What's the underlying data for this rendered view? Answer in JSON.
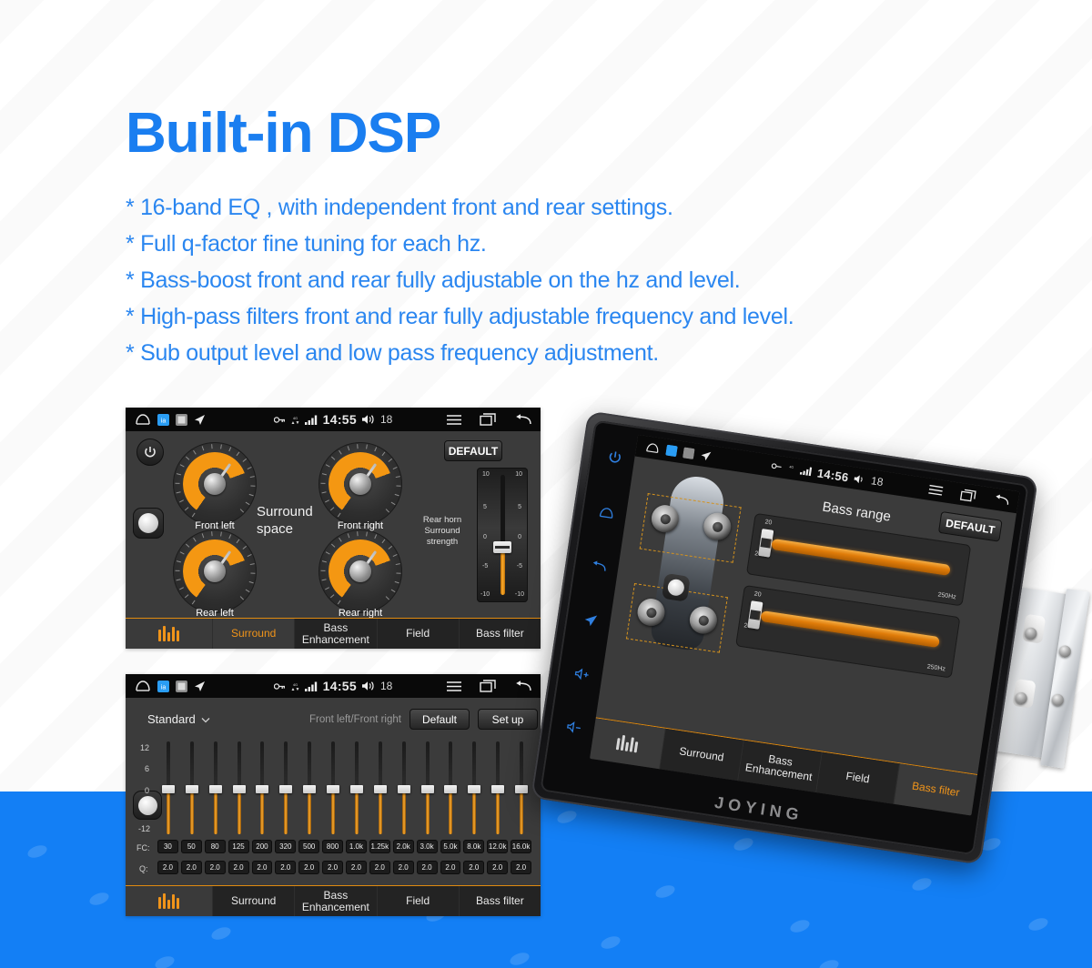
{
  "headline": "Built-in DSP",
  "bullets": [
    "* 16-band EQ , with independent front and rear settings.",
    "* Full q-factor fine tuning for each hz.",
    "* Bass-boost front and rear fully adjustable on the hz and level.",
    "* High-pass filters front and rear fully adjustable frequency and level.",
    "* Sub output level and  low pass frequency adjustment."
  ],
  "colors": {
    "brand_blue": "#1a7ef0",
    "band_blue": "#137FF5",
    "accent_orange": "#f0941a",
    "panel_dark": "#3b3b3b"
  },
  "surround_screen": {
    "statusbar": {
      "clock": "14:55",
      "volume": "18"
    },
    "default_button": "DEFAULT",
    "center_label_line1": "Surround",
    "center_label_line2": "space",
    "knobs": [
      {
        "label": "Front left"
      },
      {
        "label": "Front right"
      },
      {
        "label": "Rear left"
      },
      {
        "label": "Rear right"
      }
    ],
    "fader": {
      "title_line1": "Rear horn",
      "title_line2": "Surround",
      "title_line3": "strength",
      "scale": [
        "10",
        "5",
        "0",
        "-5",
        "-10"
      ]
    },
    "tabs": [
      {
        "label": "",
        "icon": "equalizer-icon",
        "active": false
      },
      {
        "label": "Surround",
        "active": true
      },
      {
        "label": "Bass\nEnhancement",
        "active": false
      },
      {
        "label": "Field",
        "active": false
      },
      {
        "label": "Bass filter",
        "active": false
      }
    ]
  },
  "eq_screen": {
    "statusbar": {
      "clock": "14:55",
      "volume": "18"
    },
    "preset": "Standard",
    "channel_label": "Front left/Front right",
    "default_button": "Default",
    "setup_button": "Set up",
    "axis": [
      "12",
      "6",
      "0",
      "-12"
    ],
    "fc_label": "FC:",
    "q_label": "Q:",
    "bands": [
      {
        "fc": "30",
        "q": "2.0",
        "gain": 0
      },
      {
        "fc": "50",
        "q": "2.0",
        "gain": 0
      },
      {
        "fc": "80",
        "q": "2.0",
        "gain": 0
      },
      {
        "fc": "125",
        "q": "2.0",
        "gain": 0
      },
      {
        "fc": "200",
        "q": "2.0",
        "gain": 0
      },
      {
        "fc": "320",
        "q": "2.0",
        "gain": 0
      },
      {
        "fc": "500",
        "q": "2.0",
        "gain": 0
      },
      {
        "fc": "800",
        "q": "2.0",
        "gain": 0
      },
      {
        "fc": "1.0k",
        "q": "2.0",
        "gain": 0
      },
      {
        "fc": "1.25k",
        "q": "2.0",
        "gain": 0
      },
      {
        "fc": "2.0k",
        "q": "2.0",
        "gain": 0
      },
      {
        "fc": "3.0k",
        "q": "2.0",
        "gain": 0
      },
      {
        "fc": "5.0k",
        "q": "2.0",
        "gain": 0
      },
      {
        "fc": "8.0k",
        "q": "2.0",
        "gain": 0
      },
      {
        "fc": "12.0k",
        "q": "2.0",
        "gain": 0
      },
      {
        "fc": "16.0k",
        "q": "2.0",
        "gain": 0
      }
    ],
    "tabs": [
      {
        "label": "",
        "icon": "equalizer-icon",
        "active": true
      },
      {
        "label": "Surround",
        "active": false
      },
      {
        "label": "Bass\nEnhancement",
        "active": false
      },
      {
        "label": "Field",
        "active": false
      },
      {
        "label": "Bass filter",
        "active": false
      }
    ]
  },
  "device": {
    "brand": "JOYING",
    "statusbar": {
      "clock": "14:56",
      "volume": "18"
    },
    "default_button": "DEFAULT",
    "title": "Bass range",
    "sliders": [
      {
        "value": "20",
        "min_label": "20Hz",
        "max_label": "250Hz"
      },
      {
        "value": "20",
        "min_label": "20Hz",
        "max_label": "250Hz"
      }
    ],
    "side_icons": [
      "power-icon",
      "home-icon",
      "back-icon",
      "navigation-icon",
      "volume-up-icon",
      "volume-down-icon"
    ],
    "tabs": [
      {
        "label": "",
        "icon": "equalizer-icon",
        "active": false
      },
      {
        "label": "Surround",
        "active": false
      },
      {
        "label": "Bass\nEnhancement",
        "active": false
      },
      {
        "label": "Field",
        "active": false
      },
      {
        "label": "Bass filter",
        "active": true
      }
    ]
  }
}
